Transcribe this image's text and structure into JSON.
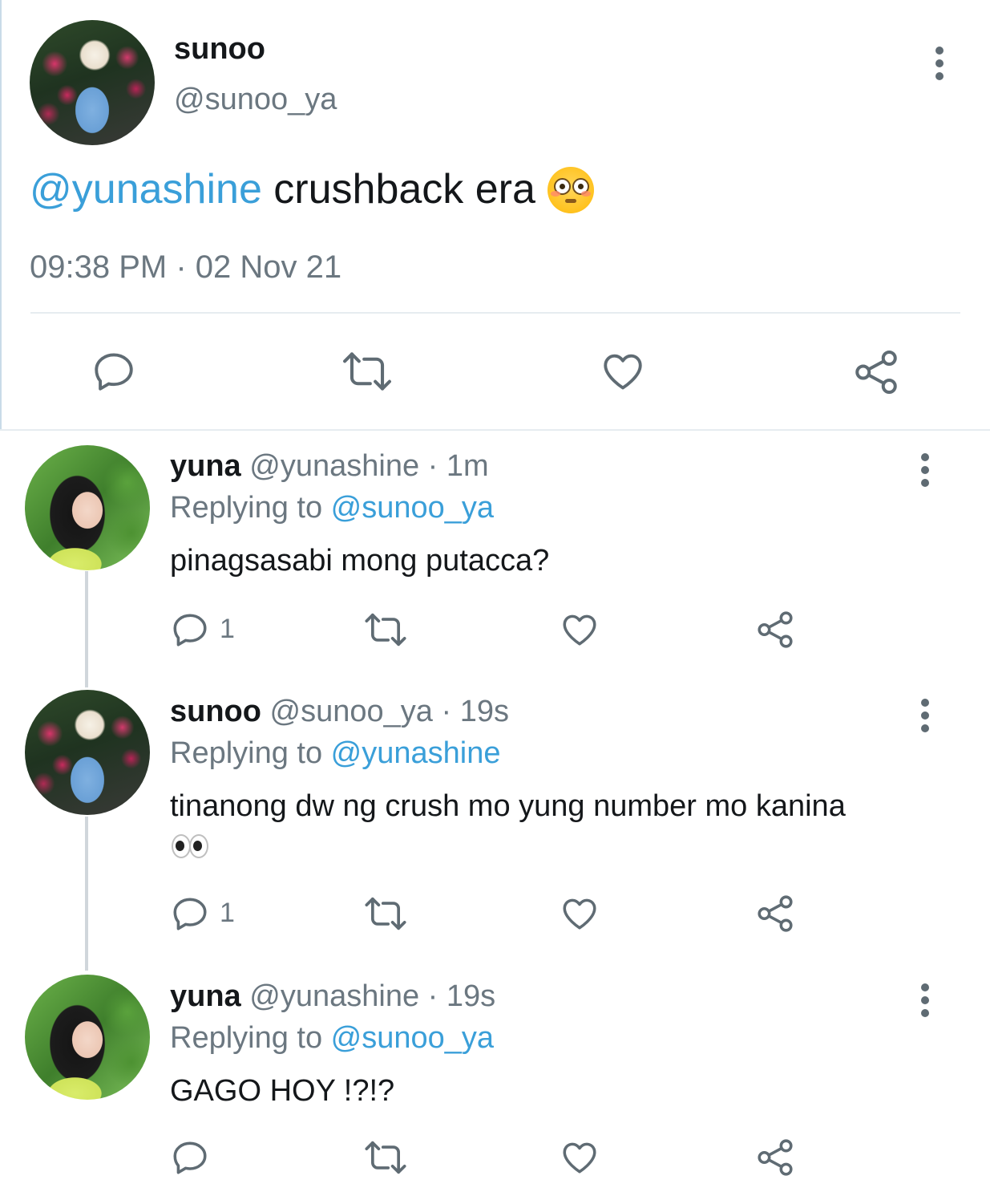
{
  "main_tweet": {
    "display_name": "sunoo",
    "handle": "@sunoo_ya",
    "mention": "@yunashine",
    "text": " crushback era",
    "emoji": "flushed-face",
    "timestamp": "09:38 PM · 02 Nov 21",
    "avatar": "sunoo-avatar"
  },
  "replies": [
    {
      "display_name": "yuna",
      "handle_time": " @yunashine · 1m",
      "replying_label": "Replying to ",
      "replying_to": "@sunoo_ya",
      "text": "pinagsasabi mong putacca?",
      "reply_count": "1",
      "avatar": "yuna-avatar"
    },
    {
      "display_name": "sunoo",
      "handle_time": " @sunoo_ya · 19s",
      "replying_label": "Replying to ",
      "replying_to": "@yunashine",
      "text": "tinanong dw ng crush mo yung number mo kanina",
      "emoji": "eyes",
      "reply_count": "1",
      "avatar": "sunoo-avatar"
    },
    {
      "display_name": "yuna",
      "handle_time": " @yunashine · 19s",
      "replying_label": "Replying to ",
      "replying_to": "@sunoo_ya",
      "text": "GAGO HOY !?!?",
      "reply_count": "",
      "avatar": "yuna-avatar"
    }
  ],
  "icons": {
    "reply": "comment-icon",
    "retweet": "retweet-icon",
    "like": "heart-icon",
    "share": "share-icon",
    "more": "more-vertical-icon"
  },
  "colors": {
    "mention": "#3a9fd9",
    "muted": "#6b7780",
    "icon": "#5f6b73"
  }
}
